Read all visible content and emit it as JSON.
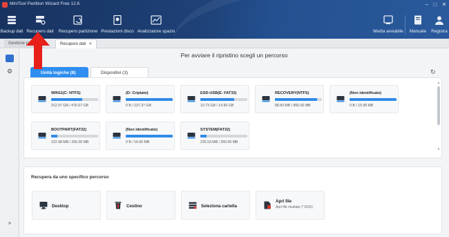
{
  "window": {
    "title": "MiniTool Partition Wizard Free 12.6",
    "controls": [
      "–",
      "□",
      "✕"
    ]
  },
  "toolbar": {
    "left": [
      {
        "label": "Backup dati",
        "icon": "backup-icon"
      },
      {
        "label": "Recupero dati",
        "icon": "data-recovery-icon"
      },
      {
        "label": "Recupero partizione",
        "icon": "partition-recovery-icon"
      },
      {
        "label": "Prestazioni disco",
        "icon": "disk-benchmark-icon"
      },
      {
        "label": "Analizzatore spazio",
        "icon": "space-analyzer-icon"
      }
    ],
    "right": [
      {
        "label": "Media avviabile",
        "icon": "bootable-media-icon"
      },
      {
        "label": "Manuale",
        "icon": "manual-icon"
      },
      {
        "label": "Registra",
        "icon": "register-icon"
      }
    ]
  },
  "tabs": [
    {
      "label": "Gestione partiz..."
    },
    {
      "label": "Recupero dati",
      "close": "✕"
    }
  ],
  "main": {
    "heading": "Per avviare il ripristino scegli un percorso",
    "drive_tabs": [
      "Unità logiche (8)",
      "Dispositivi (3)"
    ],
    "drives": [
      {
        "name": "WIN11(C: NTFS)",
        "size": "312.97 GB / 476.67 GB",
        "used": 0.66,
        "color": "#2f8be8"
      },
      {
        "name": "(D: Criptato)",
        "size": "0 B / 237.37 GB",
        "used": 1.0,
        "color": "#2f8be8"
      },
      {
        "name": "ESD-USB(E: FAT32)",
        "size": "10.73 GB / 14.90 GB",
        "used": 0.72,
        "color": "#2f8be8"
      },
      {
        "name": "RECOVERY(NTFS)",
        "size": "88.50 MB / 850.00 MB",
        "used": 0.9,
        "color": "#2f8be8"
      },
      {
        "name": "(Non identificato)",
        "size": "0 B / 15.98 MB",
        "used": 1.0,
        "color": "#2f8be8"
      },
      {
        "name": "BOOTPART(FAT32)",
        "size": "222.98 MB / 256.00 MB",
        "used": 0.13,
        "color": "#2f8be8"
      },
      {
        "name": "(Non identificato)",
        "size": "0 B / 16.00 MB",
        "used": 1.0,
        "color": "#2f8be8"
      },
      {
        "name": "SYSTEM(FAT32)",
        "size": "225.53 MB / 260.00 MB",
        "used": 0.13,
        "color": "#2f8be8"
      }
    ],
    "specific_title": "Recupera da uno specifico percorso",
    "paths": [
      {
        "label": "Desktop",
        "sub": ""
      },
      {
        "label": "Cestino",
        "sub": ""
      },
      {
        "label": "Seleziona cartella",
        "sub": ""
      },
      {
        "label": "Apri file",
        "sub": "Apri file risultato (*.RSS)"
      }
    ]
  },
  "rail": {
    "bottom_label": "»"
  },
  "colors": {
    "accent": "#2f8be8",
    "arrow": "#e8201a",
    "toolbar_bg": "#1e4178"
  }
}
